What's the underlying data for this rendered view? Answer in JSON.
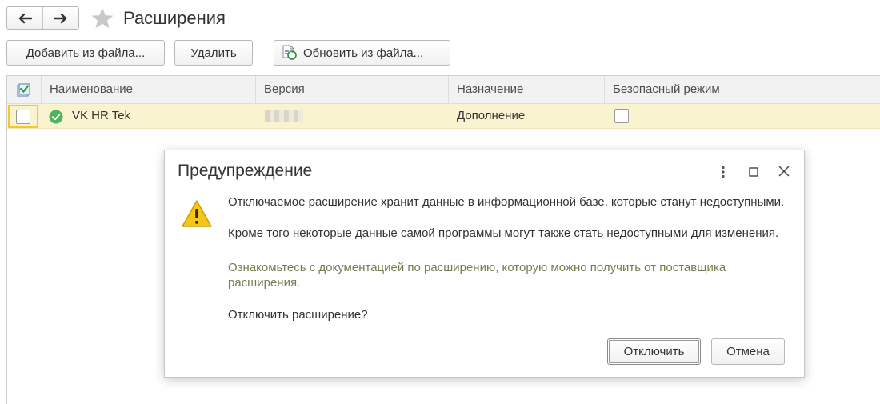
{
  "window": {
    "title": "Расширения",
    "back_icon": "arrow-left-icon",
    "forward_icon": "arrow-right-icon",
    "favorite_icon": "star-icon"
  },
  "toolbar": {
    "add_from_file": "Добавить из файла...",
    "delete": "Удалить",
    "update_from_file": "Обновить из файла..."
  },
  "table": {
    "columns": [
      "Наименование",
      "Версия",
      "Назначение",
      "Безопасный режим"
    ],
    "rows": [
      {
        "name": "VK HR Tek",
        "version": "",
        "purpose": "Дополнение",
        "active": false,
        "safe_mode": false,
        "status_icon": "check-circle-icon"
      }
    ]
  },
  "dialog": {
    "title": "Предупреждение",
    "message_line1": "Отключаемое расширение хранит данные в информационной базе, которые станут недоступными.",
    "message_line2": "Кроме того некоторые данные самой программы могут также стать недоступными для изменения.",
    "hint": "Ознакомьтесь с документацией по расширению, которую можно получить от поставщика расширения.",
    "question": "Отключить расширение?",
    "confirm_button": "Отключить",
    "cancel_button": "Отмена",
    "icon": "warning-icon"
  },
  "colors": {
    "selected_row": "#faf3d0",
    "focus_border": "#f0c830",
    "status_ok": "#4cb45a",
    "warning": "#f5c518",
    "hint_text": "#7a7a52"
  }
}
